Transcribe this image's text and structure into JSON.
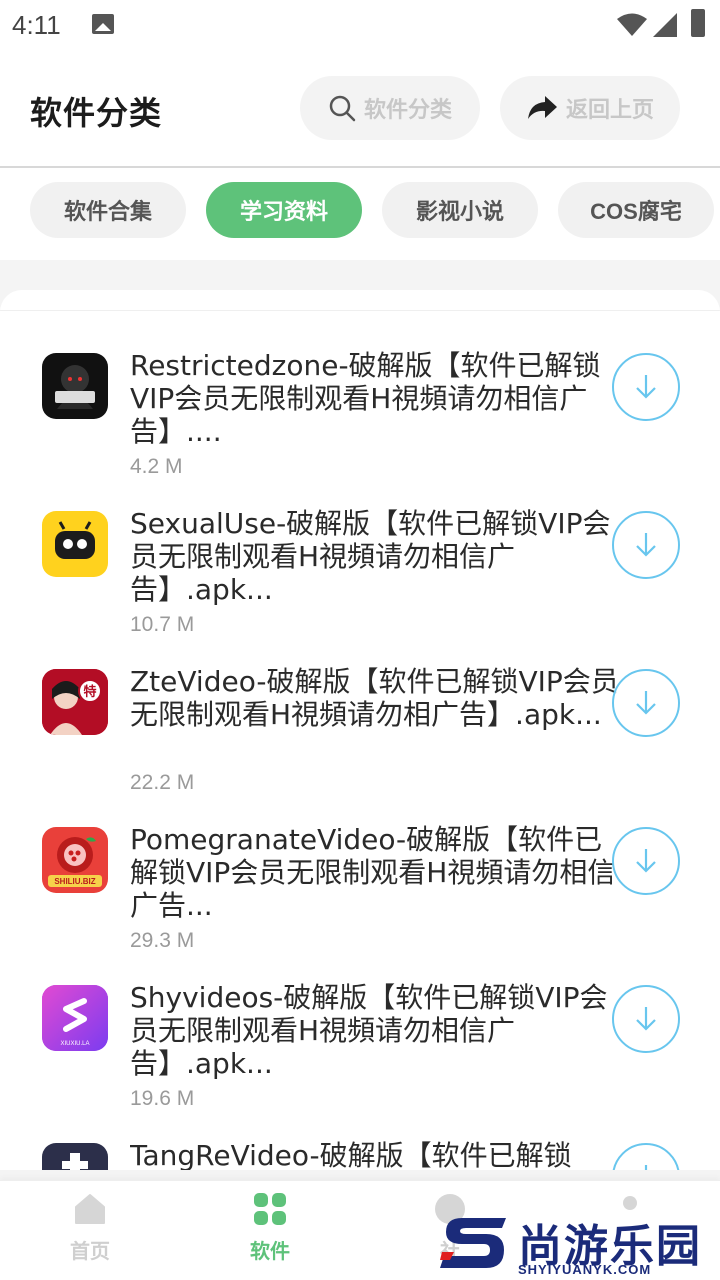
{
  "status_bar": {
    "time": "4:11"
  },
  "header": {
    "title": "软件分类",
    "search_label": "软件分类",
    "back_label": "返回上页"
  },
  "tabs": [
    {
      "label": "软件合集",
      "active": false
    },
    {
      "label": "学习资料",
      "active": true
    },
    {
      "label": "影视小说",
      "active": false
    },
    {
      "label": "COS腐宅",
      "active": false
    }
  ],
  "apps": [
    {
      "title": "Restrictedzone-破解版【软件已解锁VIP会员无限制观看H視頻请勿相信广告】....",
      "size": "4.2 M",
      "icon": "restrictedzone-icon"
    },
    {
      "title": "SexualUse-破解版【软件已解锁VIP会员无限制观看H視頻请勿相信广告】.apk...",
      "size": "10.7 M",
      "icon": "sexualuse-icon"
    },
    {
      "title": "ZteVideo-破解版【软件已解锁VIP会员无限制观看H視頻请勿相广告】.apk...",
      "size": "22.2 M",
      "icon": "ztevideo-icon"
    },
    {
      "title": "PomegranateVideo-破解版【软件已解锁VIP会员无限制观看H視頻请勿相信广告...",
      "size": "29.3 M",
      "icon": "pomegranate-icon"
    },
    {
      "title": "Shyvideos-破解版【软件已解锁VIP会员无限制观看H視頻请勿相信广告】.apk...",
      "size": "19.6 M",
      "icon": "shyvideos-icon"
    },
    {
      "title": "TangReVideo-破解版【软件已解锁",
      "size": "",
      "icon": "tangrevideo-icon"
    }
  ],
  "app_icon_labels": {
    "restrictedzone": "逃北禁地",
    "pomegranate": "SHILIU.BIZ",
    "shyvideos": "XIUXIU.LA",
    "ztevideo": "特"
  },
  "bottom_nav": [
    {
      "label": "首页",
      "icon": "home-icon",
      "active": false
    },
    {
      "label": "软件",
      "icon": "grid-icon",
      "active": true
    },
    {
      "label": "社",
      "icon": "community-icon",
      "active": false
    },
    {
      "label": "",
      "icon": "profile-icon",
      "active": false
    }
  ],
  "watermark": {
    "text": "尚游乐园",
    "url": "SHYIYUANYK.COM"
  },
  "colors": {
    "accent": "#5ec27a",
    "download_ring": "#68c6ee",
    "watermark": "#1b2b7a"
  }
}
